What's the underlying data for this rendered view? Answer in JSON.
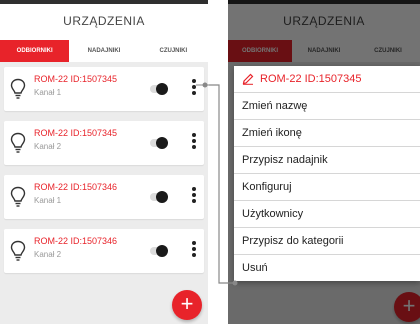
{
  "app": {
    "title": "URZĄDZENIA"
  },
  "tabs": [
    {
      "label": "ODBIORNIKI",
      "active": true
    },
    {
      "label": "NADAJNIKI",
      "active": false
    },
    {
      "label": "CZUJNIKI",
      "active": false
    }
  ],
  "devices": [
    {
      "name": "ROM-22 ID:1507345",
      "channel": "Kanał 1",
      "icon": "lightbulb-icon",
      "toggle": "off"
    },
    {
      "name": "ROM-22 ID:1507345",
      "channel": "Kanał 2",
      "icon": "lightbulb-icon",
      "toggle": "off"
    },
    {
      "name": "ROM-22 ID:1507346",
      "channel": "Kanał 1",
      "icon": "lightbulb-icon",
      "toggle": "off"
    },
    {
      "name": "ROM-22 ID:1507346",
      "channel": "Kanał 2",
      "icon": "lightbulb-icon",
      "toggle": "off"
    }
  ],
  "fab_label": "+",
  "context_menu": {
    "title": "ROM-22 ID:1507345",
    "items": [
      "Zmień nazwę",
      "Zmień ikonę",
      "Przypisz nadajnik",
      "Konfiguruj",
      "Użytkownicy",
      "Przypisz do kategorii",
      "Usuń"
    ]
  },
  "colors": {
    "accent": "#e8232a",
    "background": "#ececec",
    "text": "#222222"
  }
}
